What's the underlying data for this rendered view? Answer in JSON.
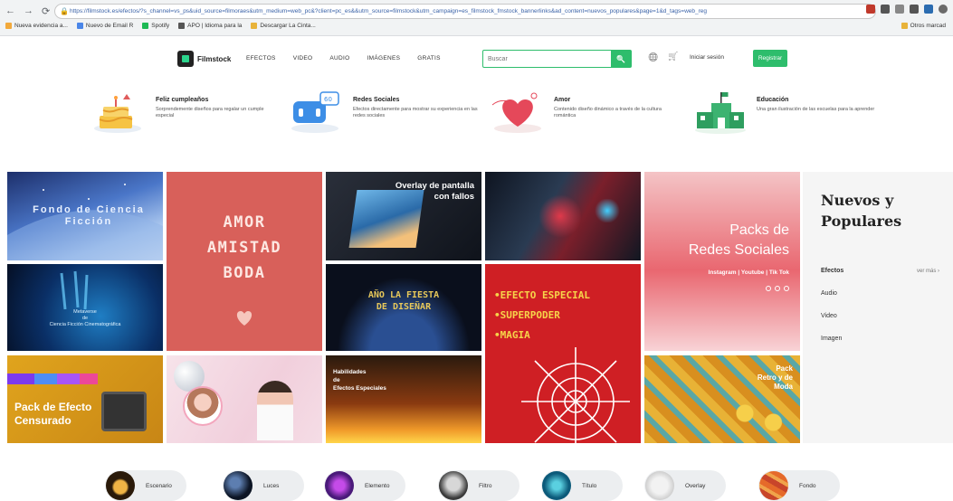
{
  "browser": {
    "nav": [
      "←",
      "→",
      "⟳"
    ],
    "url": "https://filmstock.es/efectos/?s_channel=vs_ps&uid_source=filmoraes&utm_medium=web_pc&?client=pc_es&&utm_source=filmstock&utm_campaign=es_filmstock_fmstock_bannerlinks&ad_content=nuevos_populares&page=1&d_tags=web_reg",
    "bookmarks": [
      "Nueva evidencia a...",
      "Nuevo de Email R",
      "Spotify",
      "APO | Idioma para la",
      "Descargar La Cinta..."
    ],
    "bookmark_colors": [
      "#f2a93b",
      "#4a86e8",
      "#1db954",
      "#555555",
      "#e8b33a"
    ],
    "other_bookmarks": "Otros marcad",
    "ext_colors": [
      "#c0392b",
      "#555555",
      "#888888",
      "#555555",
      "#2b6cb0",
      "#6a6a6a"
    ]
  },
  "header": {
    "logo_text": "Filmstock",
    "nav": [
      "EFECTOS",
      "VIDEO",
      "AUDIO",
      "IMÁGENES",
      "GRATIS"
    ],
    "search_placeholder": "Buscar",
    "search_icon": "🔍",
    "globe_icon": "🌐",
    "cart_icon": "🛒",
    "login": "Iniciar sesión",
    "signup": "Registrar",
    "accent": "#2ebd6c"
  },
  "categories": [
    {
      "title": "Feliz cumpleaños",
      "desc": "Sorprendemente diseños para regalar un cumple especial"
    },
    {
      "title": "Redes Sociales",
      "desc": "Efectos directamente para mostrar su experiencia en las redes sociales"
    },
    {
      "title": "Amor",
      "desc": "Contenido diseño dinámico a través de la cultura romántica"
    },
    {
      "title": "Educación",
      "desc": "Una gran ilustración de las escuelas para la aprender"
    }
  ],
  "tiles": {
    "t1": "Fondo de Ciencia Ficción",
    "t2": [
      "AMOR",
      "AMISTAD",
      "BODA"
    ],
    "t3": [
      "Overlay de pantalla",
      "con fallos"
    ],
    "t5": [
      "Packs de",
      "Redes Sociales"
    ],
    "t5_sub": "Instagram | Youtube | Tik Tok",
    "t6": [
      "Metaverse",
      "de",
      "Ciencia Ficción Cinematográfica"
    ],
    "t7": [
      "AÑO LA FIESTA",
      "DE DISEÑAR"
    ],
    "t8": [
      "•EFECTO ESPECIAL",
      "•SUPERPODER",
      "•MAGIA"
    ],
    "t9": [
      "Pack de Efecto",
      "Censurado"
    ],
    "t11": [
      "Habilidades",
      "de",
      "Efectos Especiales"
    ],
    "t12": [
      "Pack",
      "Retro y de",
      "Moda"
    ]
  },
  "side": {
    "title": "Nuevos y Populares",
    "items": [
      "Efectos",
      "Audio",
      "Video",
      "Imagen"
    ],
    "more": "ver más ›"
  },
  "pills": [
    "Escenario",
    "Luces",
    "Elemento",
    "Filtro",
    "Título",
    "Overlay",
    "Fondo"
  ]
}
